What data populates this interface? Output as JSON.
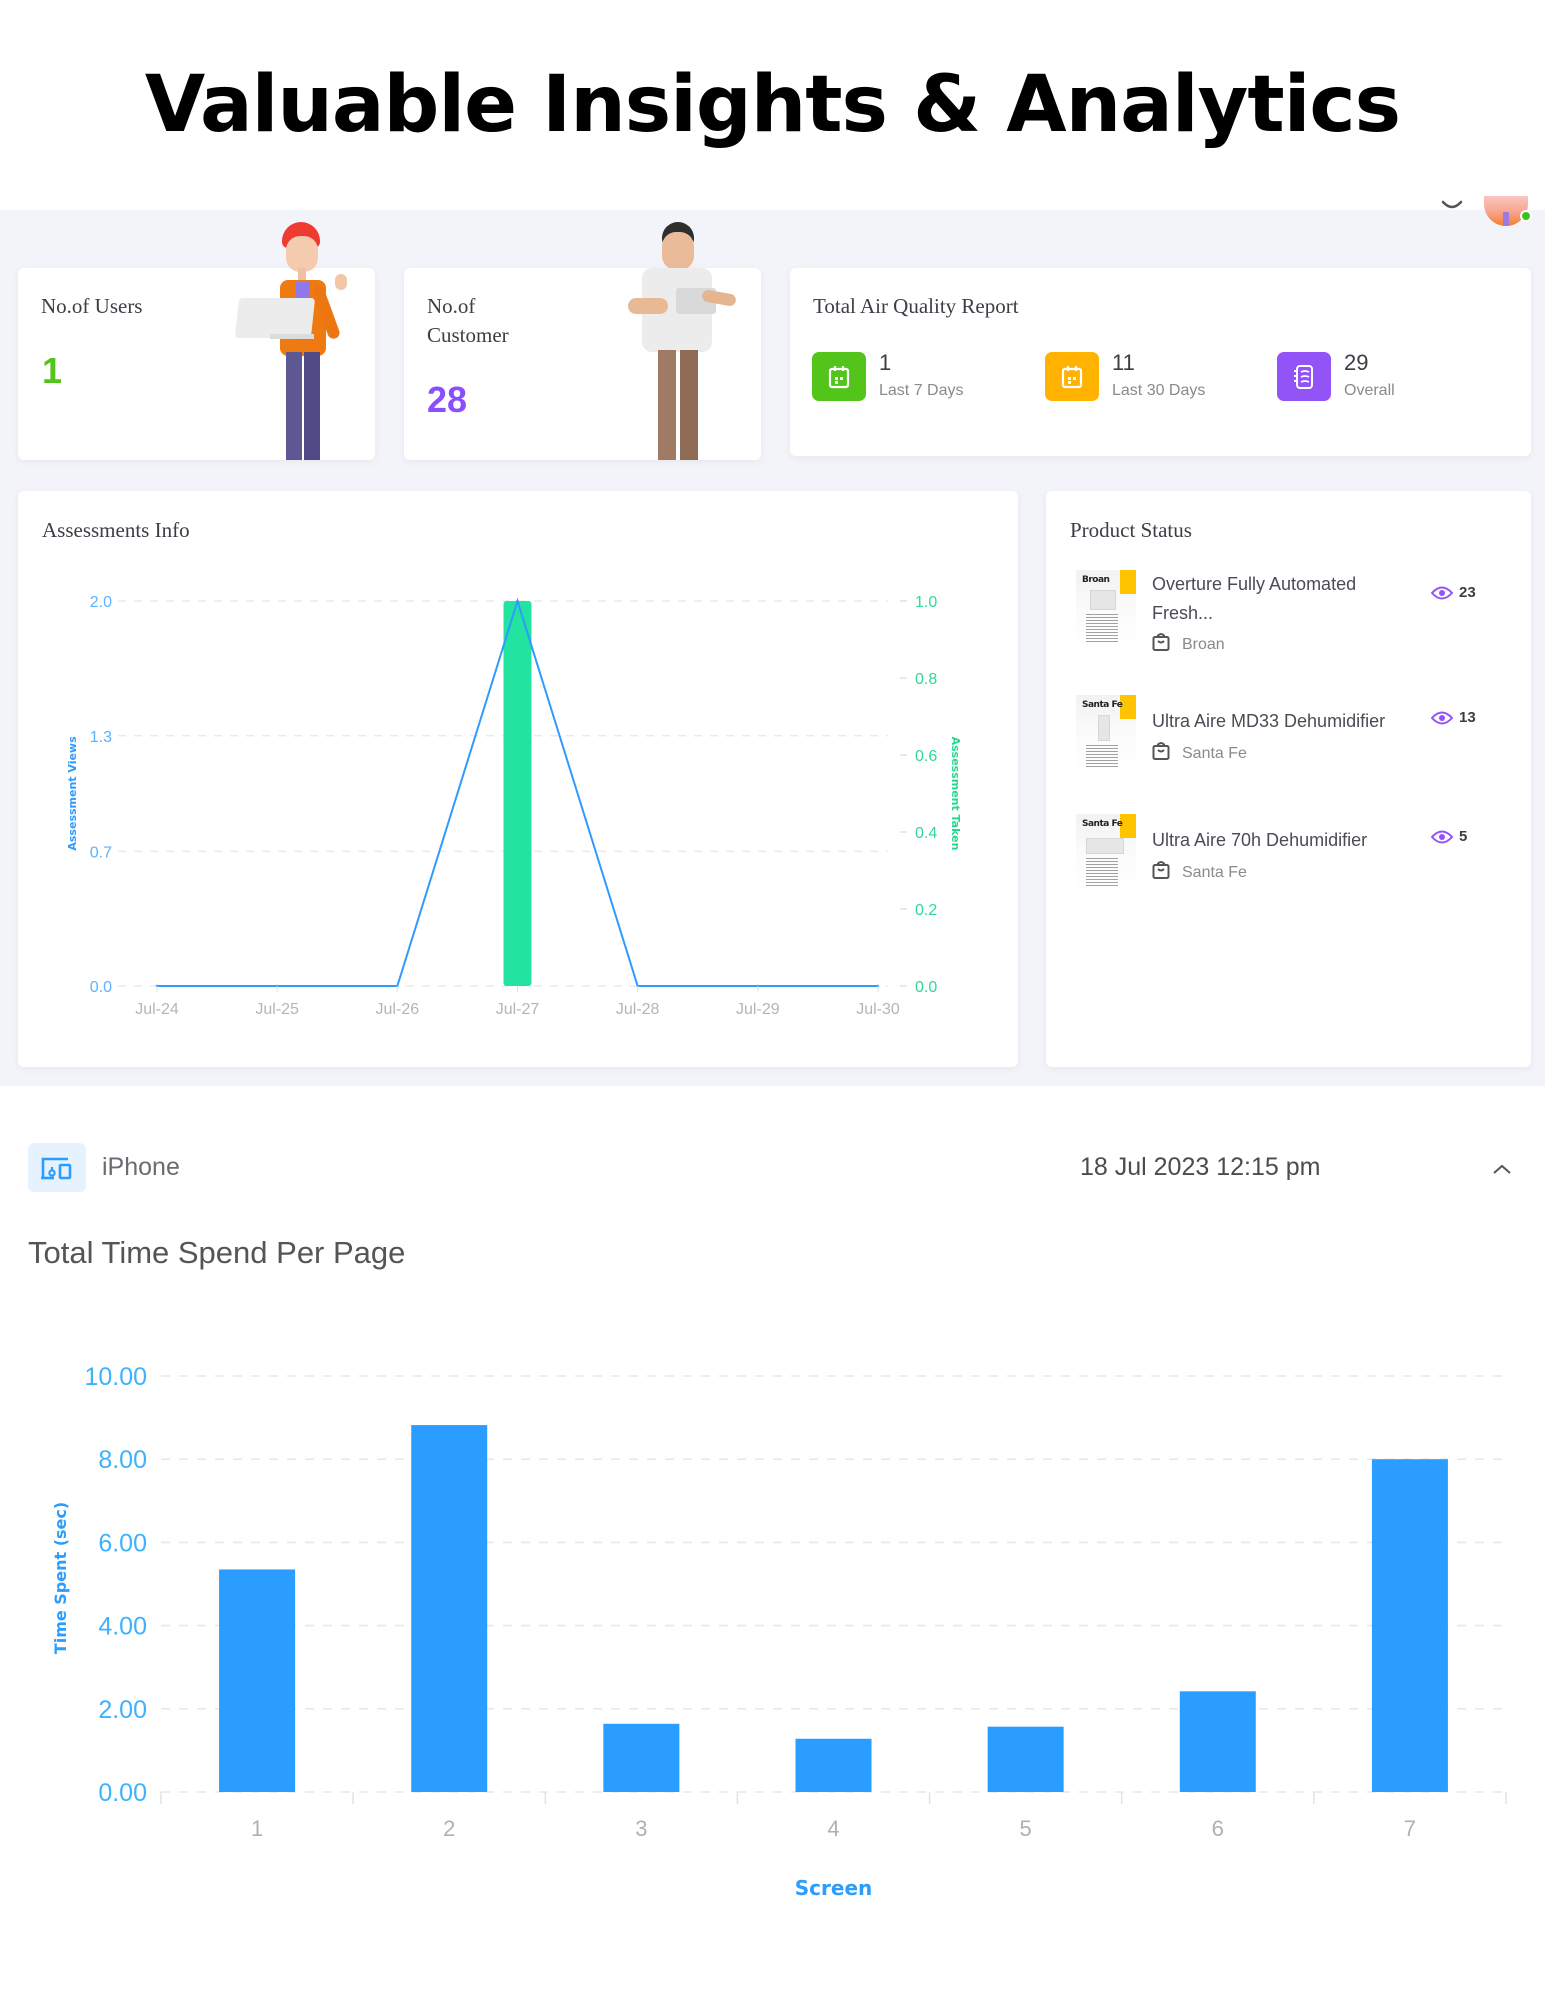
{
  "hero": {
    "title": "Valuable Insights & Analytics"
  },
  "header": {
    "avatar_status": "online"
  },
  "stats": {
    "users": {
      "label": "No.of Users",
      "value": "1",
      "color": "#52c41a"
    },
    "customers": {
      "label": "No.of Customer",
      "value": "28",
      "color": "#8a4dff"
    }
  },
  "air_quality": {
    "title": "Total Air Quality Report",
    "items": [
      {
        "value": "1",
        "label": "Last 7 Days",
        "icon": "calendar-icon",
        "color": "#52c41a"
      },
      {
        "value": "11",
        "label": "Last 30 Days",
        "icon": "calendar-icon",
        "color": "#ffb300"
      },
      {
        "value": "29",
        "label": "Overall",
        "icon": "report-icon",
        "color": "#9254f7"
      }
    ]
  },
  "assessments": {
    "title": "Assessments Info"
  },
  "products": {
    "title": "Product Status",
    "items": [
      {
        "name": "Overture Fully Automated Fresh...",
        "brand": "Broan",
        "views": "23",
        "thumb_brand": "Broan"
      },
      {
        "name": "Ultra Aire MD33 Dehumidifier",
        "brand": "Santa Fe",
        "views": "13",
        "thumb_brand": "Santa Fe"
      },
      {
        "name": "Ultra Aire 70h Dehumidifier",
        "brand": "Santa Fe",
        "views": "5",
        "thumb_brand": "Santa Fe"
      }
    ]
  },
  "session": {
    "device": "iPhone",
    "timestamp": "18 Jul 2023 12:15 pm",
    "section_title": "Total Time Spend Per Page"
  },
  "chart_data": [
    {
      "type": "line+bar",
      "title": "Assessments Info",
      "categories": [
        "Jul-24",
        "Jul-25",
        "Jul-26",
        "Jul-27",
        "Jul-28",
        "Jul-29",
        "Jul-30"
      ],
      "series": [
        {
          "name": "Assessment Views",
          "type": "line",
          "axis": "left",
          "color": "#2f9bff",
          "values": [
            0,
            0,
            0,
            2,
            0,
            0,
            0
          ]
        },
        {
          "name": "Assessment Taken",
          "type": "bar",
          "axis": "right",
          "color": "#22e39f",
          "values": [
            0,
            0,
            0,
            1,
            0,
            0,
            0
          ]
        }
      ],
      "ylabel": "Assessment Views",
      "ylabel_right": "Assessment Taken",
      "ylim": [
        0,
        2
      ],
      "ylim_right": [
        0,
        1
      ],
      "yticks": [
        "0.0",
        "0.7",
        "1.3",
        "2.0"
      ],
      "yticks_right": [
        "0.0",
        "0.2",
        "0.4",
        "0.6",
        "0.8",
        "1.0"
      ],
      "grid": true
    },
    {
      "type": "bar",
      "title": "Total Time Spend Per Page",
      "categories": [
        "1",
        "2",
        "3",
        "4",
        "5",
        "6",
        "7"
      ],
      "values": [
        5.35,
        8.82,
        1.64,
        1.28,
        1.57,
        2.42,
        8.0
      ],
      "xlabel": "Screen",
      "ylabel": "Time Spent (sec)",
      "ylim": [
        0,
        10
      ],
      "yticks": [
        "0.00",
        "2.00",
        "4.00",
        "6.00",
        "8.00",
        "10.00"
      ],
      "color": "#2a9dff",
      "grid": true
    }
  ]
}
